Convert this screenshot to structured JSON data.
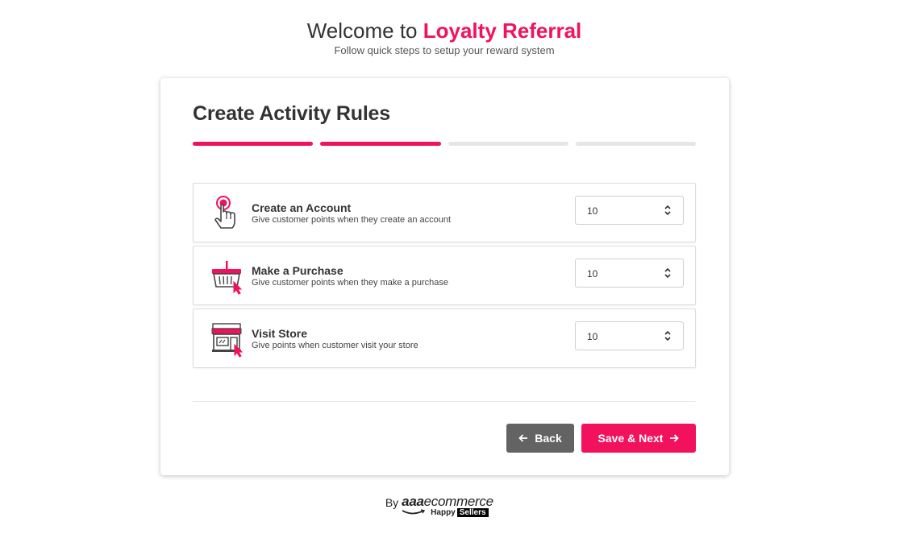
{
  "header": {
    "title_prefix": "Welcome to",
    "title_brand": "Loyalty Referral",
    "subtitle": "Follow quick steps to setup your reward system"
  },
  "card": {
    "title": "Create Activity Rules",
    "steps": {
      "total": 4,
      "completed": 2
    }
  },
  "rules": [
    {
      "icon": "click-hand-icon",
      "title": "Create an Account",
      "description": "Give customer points when they create an account",
      "points": "10"
    },
    {
      "icon": "shopping-basket-icon",
      "title": "Make a Purchase",
      "description": "Give customer points when they make a purchase",
      "points": "10"
    },
    {
      "icon": "storefront-icon",
      "title": "Visit Store",
      "description": "Give points when customer visit your store",
      "points": "10"
    }
  ],
  "buttons": {
    "back": "Back",
    "next": "Save & Next"
  },
  "footer": {
    "by": "By",
    "logo_bold": "aaa",
    "logo_rest": "ecommerce",
    "tag_a": "Happy",
    "tag_b": "Sellers"
  },
  "colors": {
    "accent": "#f1115d",
    "back_button": "#636363",
    "progress_inactive": "#e6e6e6"
  }
}
